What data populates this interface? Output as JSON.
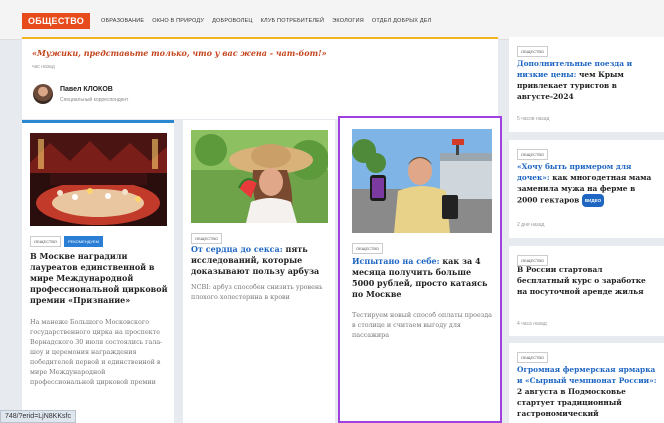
{
  "nav": {
    "logo": "ОБЩЕСТВО",
    "items": [
      "ОБРАЗОВАНИЕ",
      "ОКНО В ПРИРОДУ",
      "ДОБРОВОЛЕЦ",
      "КЛУБ ПОТРЕБИТЕЛЕЙ",
      "ЭКОЛОГИЯ",
      "ОТДЕЛ ДОБРЫХ ДЕЛ"
    ]
  },
  "quote": {
    "title": "«Мужики, представьте только, что у вас жена - чат-бот!»",
    "time": "час назад",
    "author_name": "Павел КЛОКОВ",
    "author_role": "Специальный корреспондент"
  },
  "cards": [
    {
      "tags": [
        "ОБЩЕСТВО",
        "РЕКОМЕНДУЕМ"
      ],
      "title": "В Москве наградили лауреатов единственной в мире Международной профессиональной цирковой премии «Признание»",
      "text": "На манеже Большого Московского государственного цирка на проспекте Вернадского 30 июля состоялись гала-шоу и церемония награждения победителей первой и единственной в мире Международной профессиональной цирковой премии"
    },
    {
      "tags": [
        "ОБЩЕСТВО"
      ],
      "title_hl": "От сердца до секса:",
      "title_rest": "пять исследований, которые доказывают пользу арбуза",
      "text": "NCBI: арбуз способен снизить уровень плохого холестерина в крови"
    },
    {
      "tags": [
        "ОБЩЕСТВО"
      ],
      "title_hl": "Испытано на себе:",
      "title_rest": "как за 4 месяца получить больше 5000 рублей, просто катаясь по Москве",
      "text": "Тестируем новый способ оплаты проезда в столице и считаем выгоду для пассажира"
    }
  ],
  "side": [
    {
      "tag": "ОБЩЕСТВО",
      "title_hl": "Дополнительные поезда и низкие цены:",
      "title_rest": "чем Крым привлекает туристов в августе-2024",
      "time": "5 часов назад"
    },
    {
      "tag": "ОБЩЕСТВО",
      "title_hl": "«Хочу быть примером для дочек»:",
      "title_rest": "как многодетная мама заменила мужа на ферме в 2000 гектаров",
      "badge": "ВИДЕО",
      "time": "2 дня назад"
    },
    {
      "tag": "ОБЩЕСТВО",
      "title_hl": "",
      "title_rest": "В России стартовал бесплатный курс о заработке на посуточной аренде жилья",
      "time": "4 часа назад"
    },
    {
      "tag": "ОБЩЕСТВО",
      "title_hl": "Огромная фермерская ярмарка и «Сырный чемпионат России»:",
      "title_rest": "2 августа в Подмосковье стартует традиционный гастрономический",
      "time": ""
    }
  ],
  "status_url": "748/?erid=LjN8KKsfc"
}
